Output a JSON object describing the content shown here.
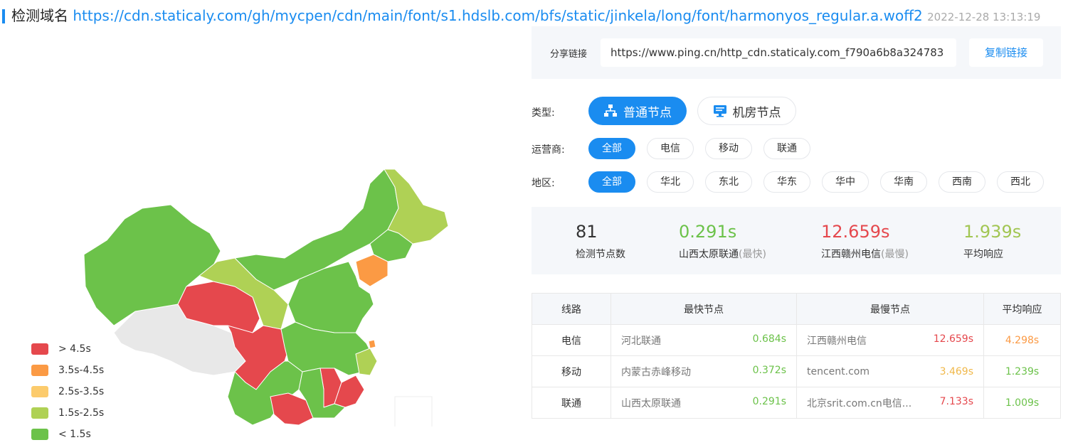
{
  "header": {
    "title": "检测域名",
    "url": "https://cdn.staticaly.com/gh/mycpen/cdn/main/font/s1.hdslb.com/bfs/static/jinkela/long/font/harmonyos_regular.a.woff2",
    "date": "2022-12-28 13:13:19"
  },
  "share": {
    "label": "分享链接",
    "link": "https://www.ping.cn/http_cdn.staticaly.com_f790a6b8a324783",
    "copy": "复制链接"
  },
  "type": {
    "label": "类型:",
    "options": [
      "普通节点",
      "机房节点"
    ],
    "selected": "普通节点"
  },
  "isp": {
    "label": "运营商:",
    "options": [
      "全部",
      "电信",
      "移动",
      "联通"
    ],
    "selected": "全部"
  },
  "region": {
    "label": "地区:",
    "options": [
      "全部",
      "华北",
      "东北",
      "华东",
      "华中",
      "华南",
      "西南",
      "西北"
    ],
    "selected": "全部"
  },
  "stats": [
    {
      "value": "81",
      "label": "检测节点数",
      "note": "",
      "color": "#333333"
    },
    {
      "value": "0.291s",
      "label": "山西太原联通",
      "note": "(最快)",
      "color": "#6cc24a"
    },
    {
      "value": "12.659s",
      "label": "江西赣州电信",
      "note": "(最慢)",
      "color": "#e5484d"
    },
    {
      "value": "1.939s",
      "label": "平均响应",
      "note": "",
      "color": "#a2c653"
    }
  ],
  "legend": [
    {
      "label": "> 4.5s",
      "color": "#e5484d"
    },
    {
      "label": "3.5s-4.5s",
      "color": "#fb9a44"
    },
    {
      "label": "2.5s-3.5s",
      "color": "#fccb6c"
    },
    {
      "label": "1.5s-2.5s",
      "color": "#afd155"
    },
    {
      "label": "< 1.5s",
      "color": "#6cc24a"
    }
  ],
  "table": {
    "headers": [
      "线路",
      "最快节点",
      "最慢节点",
      "平均响应"
    ],
    "rows": [
      {
        "route": "电信",
        "fast_node": "河北联通",
        "fast_time": "0.684s",
        "fast_color": "#6cc24a",
        "slow_node": "江西赣州电信",
        "slow_time": "12.659s",
        "slow_color": "#e5484d",
        "avg": "4.298s",
        "avg_color": "#fb9a44"
      },
      {
        "route": "移动",
        "fast_node": "内蒙古赤峰移动",
        "fast_time": "0.372s",
        "fast_color": "#6cc24a",
        "slow_node": "tencent.com",
        "slow_time": "3.469s",
        "slow_color": "#fccb6c",
        "avg": "1.239s",
        "avg_color": "#6cc24a"
      },
      {
        "route": "联通",
        "fast_node": "山西太原联通",
        "fast_time": "0.291s",
        "fast_color": "#6cc24a",
        "slow_node": "北京srit.com.cn电信...",
        "slow_time": "7.133s",
        "slow_color": "#e5484d",
        "avg": "1.009s",
        "avg_color": "#6cc24a"
      }
    ]
  }
}
